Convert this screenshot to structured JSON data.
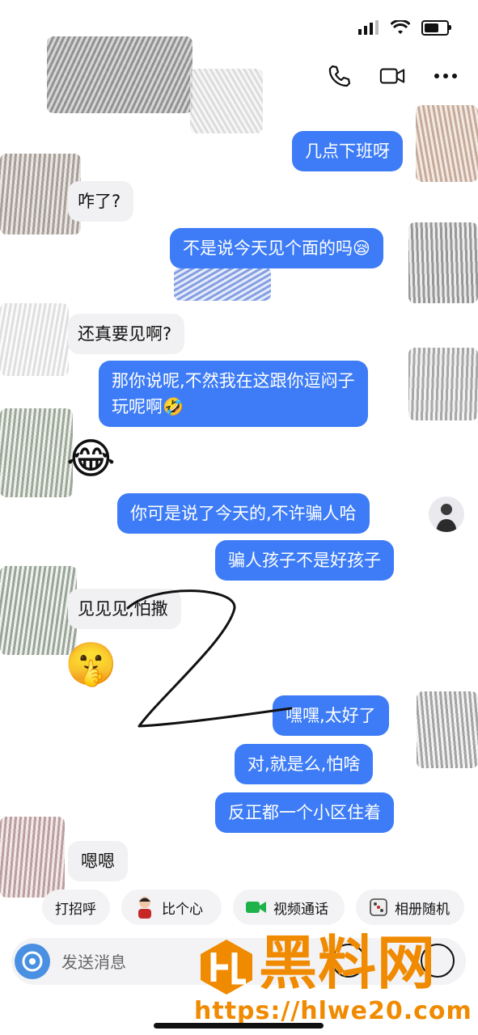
{
  "messages": [
    {
      "side": "out",
      "text": "几点下班呀"
    },
    {
      "side": "in",
      "text": "咋了?"
    },
    {
      "side": "out",
      "text": "不是说今天见个面的吗😪"
    },
    {
      "side": "in",
      "text": "还真要见啊?"
    },
    {
      "side": "out",
      "line1": "那你说呢,不然我在这跟你逗闷子",
      "line2": "玩呢啊🤣"
    },
    {
      "side": "in",
      "emoji": "😂"
    },
    {
      "side": "out",
      "text": "你可是说了今天的,不许骗人哈"
    },
    {
      "side": "out",
      "text": "骗人孩子不是好孩子"
    },
    {
      "side": "in",
      "text": "见见见,怕撒"
    },
    {
      "side": "in",
      "emoji": "🤫"
    },
    {
      "side": "out",
      "text": "嘿嘿,太好了"
    },
    {
      "side": "out",
      "text": "对,就是么,怕啥"
    },
    {
      "side": "out",
      "text": "反正都一个小区住着"
    },
    {
      "side": "in",
      "text": "嗯嗯"
    }
  ],
  "quick_actions": [
    {
      "label": "打招呼",
      "icon": ""
    },
    {
      "label": "比个心",
      "icon": "avatar-sticker-icon"
    },
    {
      "label": "视频通话",
      "icon": "video-camera-icon"
    },
    {
      "label": "相册随机",
      "icon": "dice-icon"
    }
  ],
  "input": {
    "placeholder": "发送消息"
  },
  "header": {
    "icons": [
      "phone-icon",
      "video-call-icon",
      "more-icon"
    ]
  },
  "watermark": {
    "brand": "黑料网",
    "url": "https://hlwe20.com"
  },
  "status": {
    "battery_level": 0.7
  },
  "colors": {
    "outgoing": "#3d7cf6",
    "incoming": "#f1f1f3",
    "watermark": "#f08a00"
  }
}
